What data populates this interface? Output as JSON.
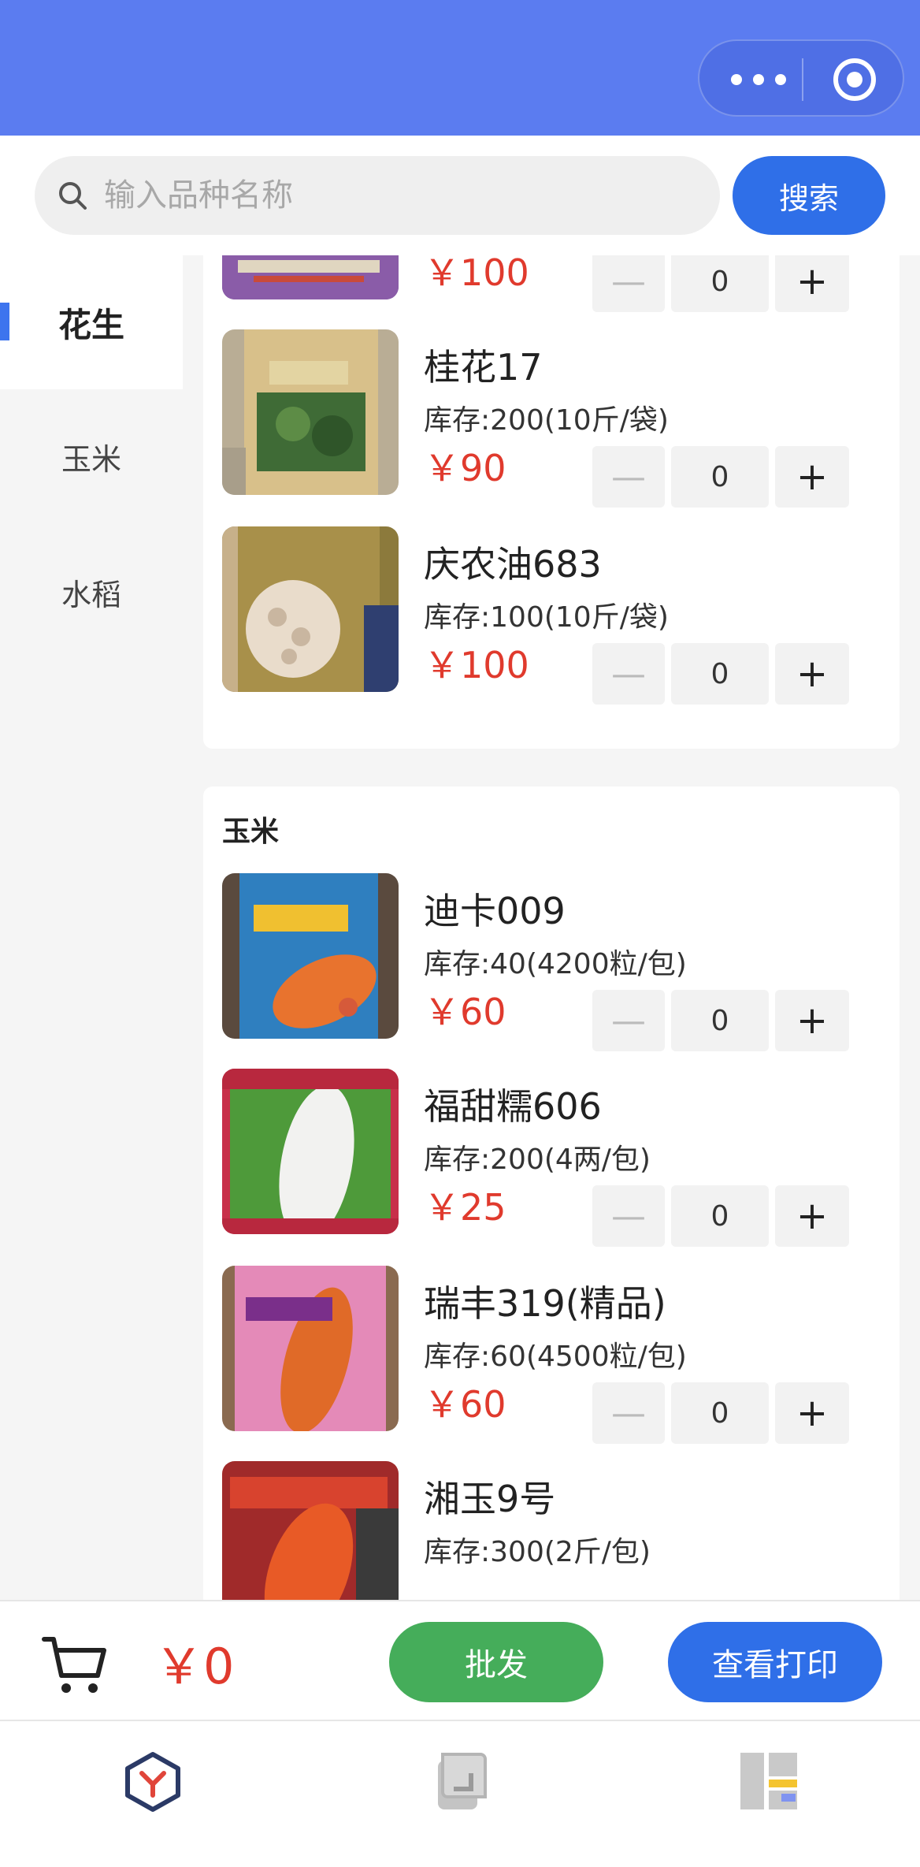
{
  "search": {
    "placeholder": "输入品种名称",
    "button_label": "搜索"
  },
  "sidebar": {
    "items": [
      {
        "label": "花生",
        "active": true
      },
      {
        "label": "玉米",
        "active": false
      },
      {
        "label": "水稻",
        "active": false
      }
    ]
  },
  "sections": [
    {
      "title": "",
      "products": [
        {
          "name": "",
          "stock": "",
          "price": "￥100",
          "qty": "0"
        },
        {
          "name": "桂花17",
          "stock": "库存:200(10斤/袋)",
          "price": "￥90",
          "qty": "0"
        },
        {
          "name": "庆农油683",
          "stock": "库存:100(10斤/袋)",
          "price": "￥100",
          "qty": "0"
        }
      ]
    },
    {
      "title": "玉米",
      "products": [
        {
          "name": "迪卡009",
          "stock": "库存:40(4200粒/包)",
          "price": "￥60",
          "qty": "0"
        },
        {
          "name": "福甜糯606",
          "stock": "库存:200(4两/包)",
          "price": "￥25",
          "qty": "0"
        },
        {
          "name": "瑞丰319(精品)",
          "stock": "库存:60(4500粒/包)",
          "price": "￥60",
          "qty": "0"
        },
        {
          "name": "湘玉9号",
          "stock": "库存:300(2斤/包)",
          "price": "",
          "qty": ""
        }
      ]
    }
  ],
  "stepper": {
    "minus": "—",
    "plus": "+"
  },
  "cart": {
    "total": "￥0",
    "wholesale_label": "批发",
    "print_label": "查看打印"
  },
  "colors": {
    "header": "#5b7cf0",
    "primary": "#2f6fe8",
    "green": "#45ad5a",
    "price": "#e03a2d"
  }
}
